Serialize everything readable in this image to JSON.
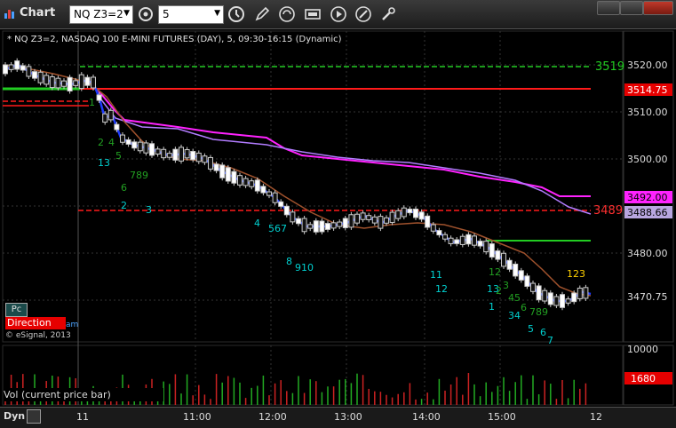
{
  "window": {
    "title": "Chart"
  },
  "toolbar": {
    "symbol_value": "NQ Z3=2",
    "interval_value": "5",
    "buttons": [
      "clock-icon",
      "pencil-icon",
      "cursor-icon",
      "data-icon",
      "play-icon",
      "link-icon",
      "settings-icon"
    ]
  },
  "chart": {
    "info_text": "* NQ Z3=2, NASDAQ 100 E-MINI FUTURES (DAY), 5, 09:30-16:15 (Dynamic)",
    "price_labels": [
      "3520.00",
      "3510.00",
      "3500.00",
      "3480.00"
    ],
    "level_labels": {
      "green_level": "3519",
      "red_level": "3489",
      "red_price": "3514.75",
      "magenta_price": "3492.00",
      "purple_price": "3488.66",
      "last_price": "3470.75"
    },
    "count_labels": [
      {
        "text": "1",
        "color": "#22a022"
      },
      {
        "text": "2",
        "color": "#22a022"
      },
      {
        "text": "4",
        "color": "#22a022"
      },
      {
        "text": "5",
        "color": "#22a022"
      },
      {
        "text": "13",
        "color": "#00d0d0"
      },
      {
        "text": "6",
        "color": "#22a022"
      },
      {
        "text": "789",
        "color": "#22a022"
      },
      {
        "text": "2",
        "color": "#00d0d0"
      },
      {
        "text": "3",
        "color": "#00d0d0"
      },
      {
        "text": "4",
        "color": "#00d0d0"
      },
      {
        "text": "567",
        "color": "#00d0d0"
      },
      {
        "text": "8",
        "color": "#00d0d0"
      },
      {
        "text": "910",
        "color": "#00d0d0"
      },
      {
        "text": "11",
        "color": "#00d0d0"
      },
      {
        "text": "12",
        "color": "#00d0d0"
      },
      {
        "text": "12",
        "color": "#22a022"
      },
      {
        "text": "13",
        "color": "#00d0d0"
      },
      {
        "text": "2",
        "color": "#22a022"
      },
      {
        "text": "3",
        "color": "#22a022"
      },
      {
        "text": "45",
        "color": "#22a022"
      },
      {
        "text": "1",
        "color": "#00d0d0"
      },
      {
        "text": "34",
        "color": "#00d0d0"
      },
      {
        "text": "6",
        "color": "#22a022"
      },
      {
        "text": "789",
        "color": "#22a022"
      },
      {
        "text": "5",
        "color": "#00d0d0"
      },
      {
        "text": "6",
        "color": "#00d0d0"
      },
      {
        "text": "7",
        "color": "#00d0d0"
      },
      {
        "text": "123",
        "color": "#ffd000"
      }
    ],
    "pc_label": "Pc",
    "direction_label": "Direction",
    "direction_tail": "am",
    "copyright": "© eSignal, 2013"
  },
  "volume": {
    "label": "Vol (current price bar)",
    "scale_label": "10000",
    "value_label": "1680"
  },
  "x_axis": {
    "dyn_label": "Dyn",
    "times": [
      "11",
      "11:00",
      "12:00",
      "13:00",
      "14:00",
      "15:00",
      "12"
    ]
  }
}
